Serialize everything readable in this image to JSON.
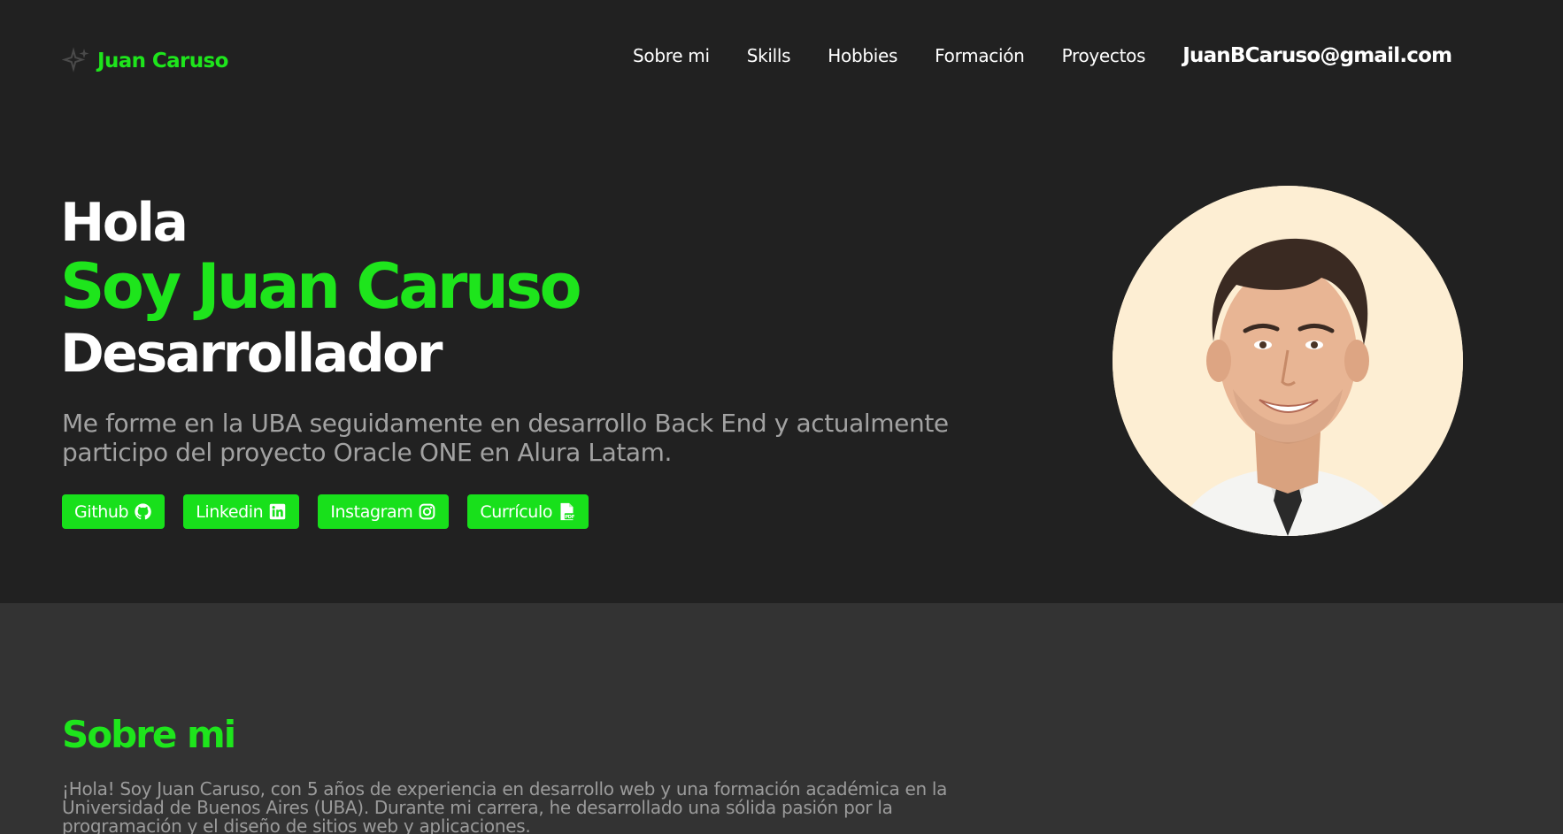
{
  "header": {
    "brand_name": "Juan Caruso",
    "brand_icon": "sparkles-icon",
    "nav": [
      "Sobre mi",
      "Skills",
      "Hobbies",
      "Formación",
      "Proyectos"
    ],
    "email": "JuanBCaruso@gmail.com"
  },
  "hero": {
    "greeting": "Hola",
    "name": "Soy Juan Caruso",
    "role": "Desarrollador",
    "description": "Me forme en la UBA seguidamente en desarrollo Back End y actualmente participo del proyecto Oracle ONE en Alura Latam.",
    "buttons": [
      {
        "label": "Github",
        "icon": "github-icon"
      },
      {
        "label": "Linkedin",
        "icon": "linkedin-icon"
      },
      {
        "label": "Instagram",
        "icon": "instagram-icon"
      },
      {
        "label": "Currículo",
        "icon": "pdf-file-icon"
      }
    ]
  },
  "about": {
    "title": "Sobre mi",
    "text": "¡Hola! Soy Juan Caruso, con 5 años de experiencia en desarrollo web y una formación académica en la Universidad de Buenos Aires (UBA). Durante mi carrera, he desarrollado una sólida pasión por la programación y el diseño de sitios web y aplicaciones."
  },
  "colors": {
    "background": "#212121",
    "section_background": "#333333",
    "accent": "#1ee51c",
    "muted_text": "#a2a2a2"
  }
}
